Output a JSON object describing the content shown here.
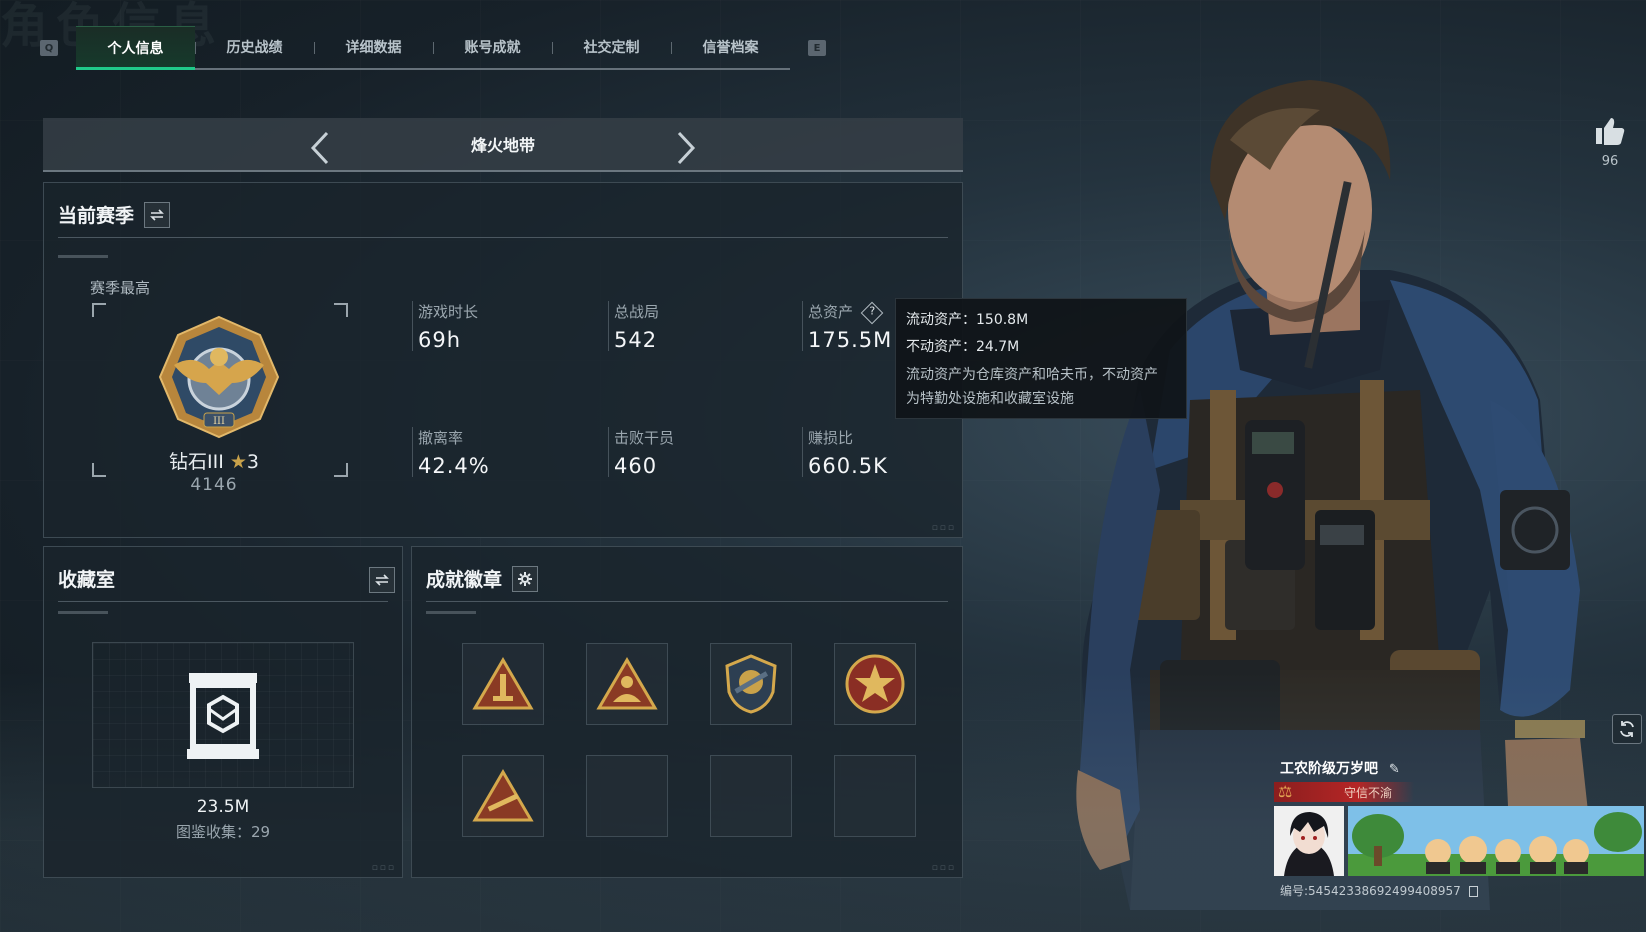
{
  "background": {
    "title_text": "角色信息"
  },
  "tabs": {
    "key_left": "Q",
    "key_right": "E",
    "items": [
      {
        "label": "个人信息",
        "active": true
      },
      {
        "label": "历史战绩",
        "active": false
      },
      {
        "label": "详细数据",
        "active": false
      },
      {
        "label": "账号成就",
        "active": false
      },
      {
        "label": "社交定制",
        "active": false
      },
      {
        "label": "信誉档案",
        "active": false
      }
    ]
  },
  "mode": {
    "title": "烽火地带"
  },
  "season": {
    "title": "当前赛季",
    "peak_label": "赛季最高",
    "rank_name": "钻石III",
    "rank_stars": "3",
    "rank_score": "4146",
    "stats": [
      {
        "label": "游戏时长",
        "value": "69h"
      },
      {
        "label": "总战局",
        "value": "542"
      },
      {
        "label": "总资产",
        "value": "175.5M"
      },
      {
        "label": "撤离率",
        "value": "42.4%"
      },
      {
        "label": "击败干员",
        "value": "460"
      },
      {
        "label": "赚损比",
        "value": "660.5K"
      }
    ]
  },
  "tooltip": {
    "liquid": "流动资产：150.8M",
    "fixed": "不动资产：24.7M",
    "desc_line1": "流动资产为仓库资产和哈夫币，不动资产",
    "desc_line2": "为特勤处设施和收藏室设施"
  },
  "collection": {
    "title": "收藏室",
    "value": "23.5M",
    "catalog": "图鉴收集：29"
  },
  "achievements": {
    "title": "成就徽章",
    "badges": [
      "warning-triangle-badge",
      "soldier-triangle-badge",
      "shield-emblem-badge",
      "star-medal-badge",
      "rifle-triangle-badge",
      "empty",
      "empty",
      "empty"
    ]
  },
  "profile": {
    "likes": "96",
    "name": "工农阶级万岁吧",
    "badge": "守信不渝",
    "uid": "编号:545423386924994089​57"
  },
  "colors": {
    "accent": "#20c98a",
    "tab_active_bg": "#163a2c",
    "badge_red": "#b52626",
    "medal_gold": "#c9a24a"
  }
}
